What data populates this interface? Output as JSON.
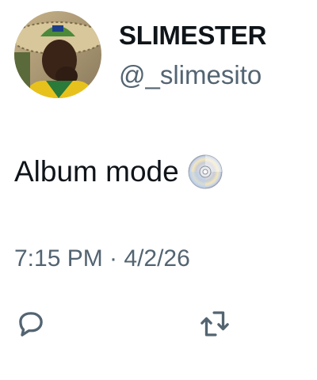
{
  "author": {
    "display_name": "SLIMESTER",
    "handle": "@_slimesito"
  },
  "tweet": {
    "text": "Album mode",
    "emoji_icon": "optical-disc-icon",
    "timestamp": "7:15 PM · 4/2/26"
  },
  "actions": [
    {
      "icon": "reply-icon"
    },
    {
      "icon": "retweet-icon"
    }
  ],
  "colors": {
    "text_primary": "#0f1419",
    "text_secondary": "#536471",
    "background": "#ffffff"
  }
}
